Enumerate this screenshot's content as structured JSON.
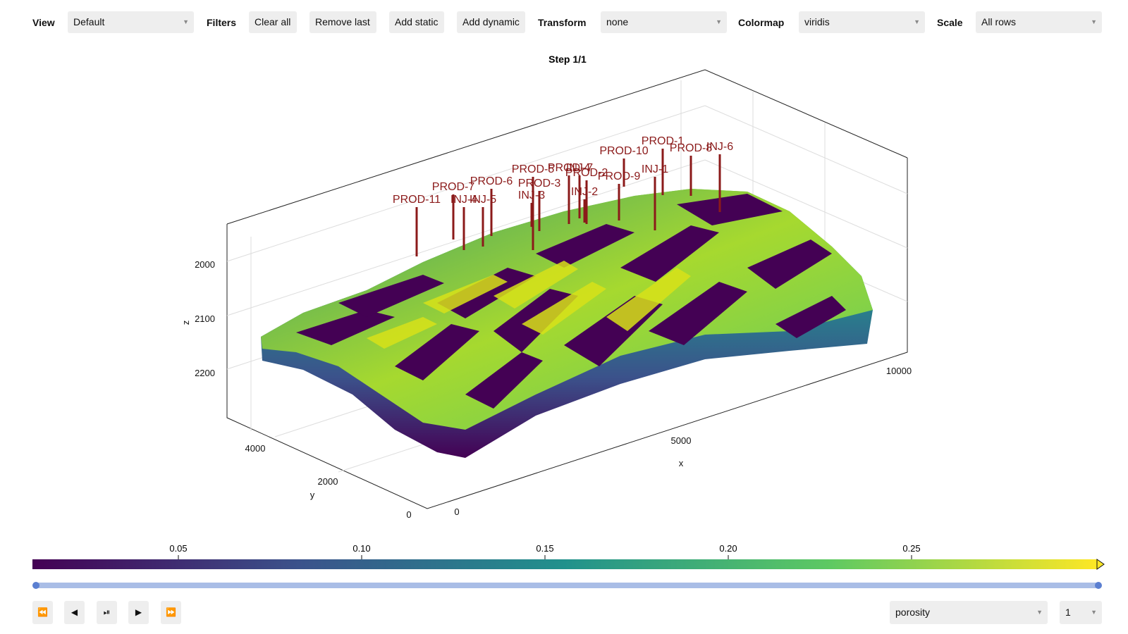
{
  "toolbar": {
    "view_label": "View",
    "view_value": "Default",
    "filters_label": "Filters",
    "clear_all": "Clear all",
    "remove_last": "Remove last",
    "add_static": "Add static",
    "add_dynamic": "Add dynamic",
    "transform_label": "Transform",
    "transform_value": "none",
    "colormap_label": "Colormap",
    "colormap_value": "viridis",
    "scale_label": "Scale",
    "scale_value": "All rows"
  },
  "plot": {
    "title": "Step 1/1",
    "xlabel": "x",
    "ylabel": "y",
    "zlabel": "z",
    "x_ticks": [
      "0",
      "5000",
      "10000"
    ],
    "y_ticks": [
      "0",
      "2000",
      "4000"
    ],
    "z_ticks": [
      "2000",
      "2100",
      "2200"
    ],
    "well_color": "#8b1a1a",
    "wells": [
      "PROD-11",
      "PROD-7",
      "INJ-4",
      "INJ-5",
      "PROD-6",
      "PROD-5",
      "PROD-3",
      "INJ-3",
      "PROD-4",
      "INJ-7",
      "PROD-2",
      "INJ-2",
      "PROD-9",
      "PROD-10",
      "INJ-1",
      "PROD-1",
      "PROD-8",
      "INJ-6"
    ]
  },
  "colorbar": {
    "colormap": "viridis",
    "ticks": [
      "0.05",
      "0.10",
      "0.15",
      "0.20",
      "0.25"
    ],
    "colors": [
      "#440154",
      "#3b528b",
      "#21918c",
      "#5ec962",
      "#fde725"
    ]
  },
  "timeline": {
    "progress": 1.0,
    "accent": "#5b7fd1"
  },
  "playback": {
    "variable_value": "porosity",
    "step_value": "1"
  }
}
